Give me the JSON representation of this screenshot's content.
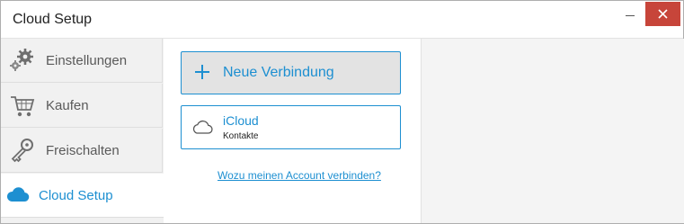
{
  "window": {
    "title": "Cloud Setup"
  },
  "sidebar": {
    "items": [
      {
        "label": "Einstellungen",
        "icon": "gears-icon"
      },
      {
        "label": "Kaufen",
        "icon": "cart-icon"
      },
      {
        "label": "Freischalten",
        "icon": "key-icon"
      },
      {
        "label": "Cloud Setup",
        "icon": "cloud-icon",
        "active": true
      }
    ]
  },
  "main": {
    "new_connection_label": "Neue Verbindung",
    "connections": [
      {
        "name": "iCloud",
        "type": "Kontakte",
        "icon": "cloud-outline-icon"
      }
    ],
    "help_link": "Wozu meinen Account verbinden?"
  },
  "colors": {
    "accent": "#1d8fd1",
    "close_button": "#c7453a",
    "sidebar_bg": "#f1f1f1"
  }
}
